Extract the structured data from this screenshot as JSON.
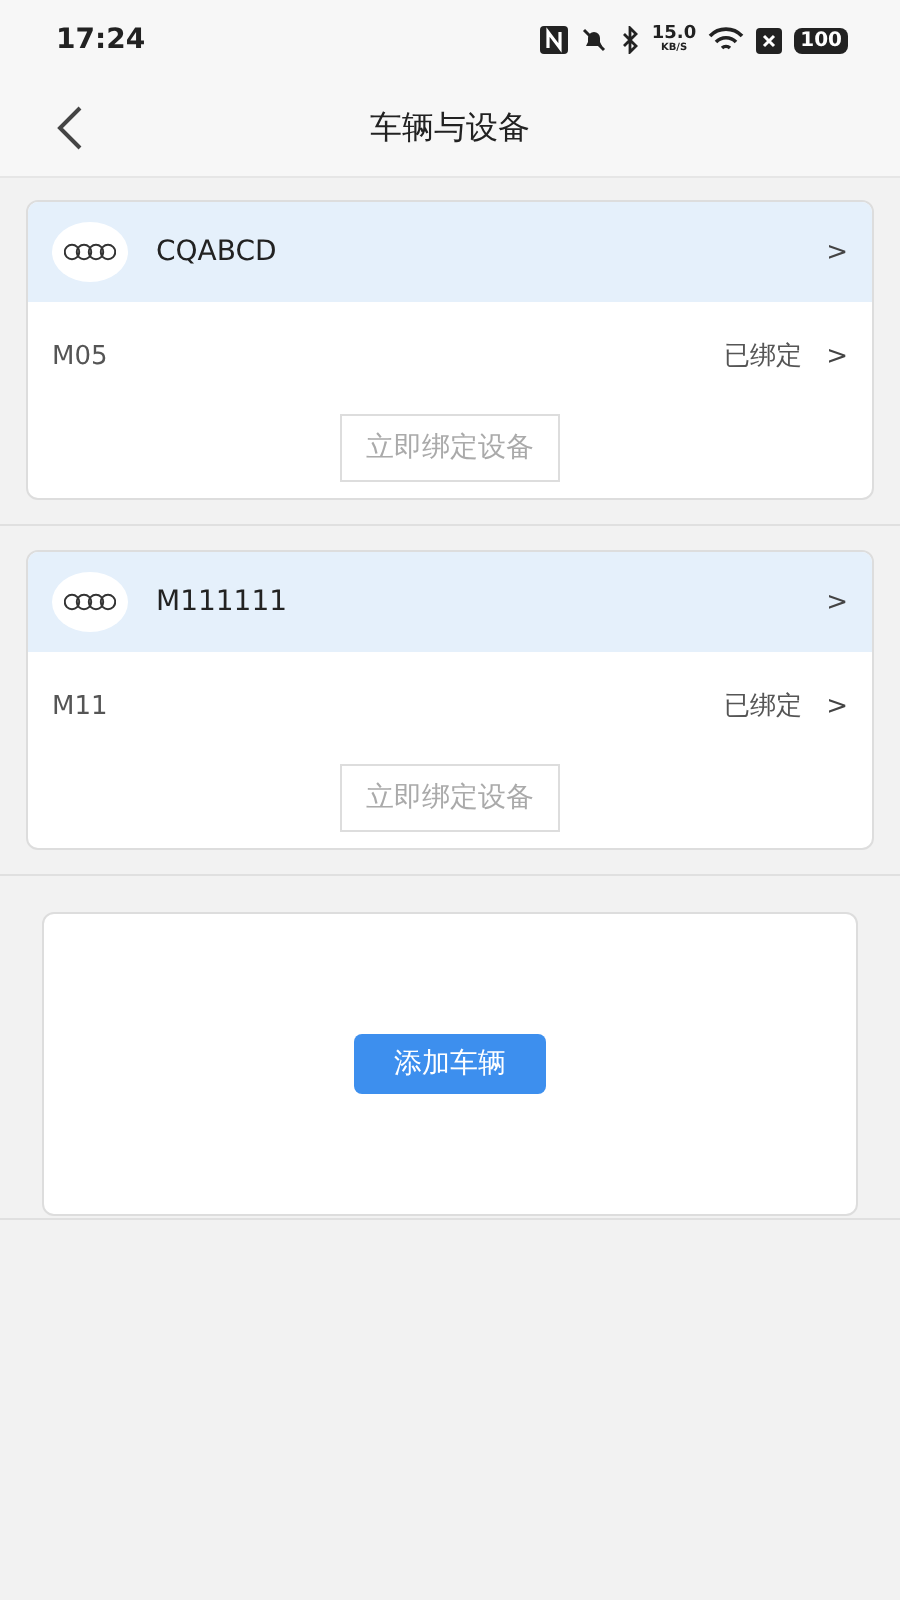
{
  "status_bar": {
    "time": "17:24",
    "speed": "15.0",
    "speed_unit": "KB/S",
    "battery": "100"
  },
  "header": {
    "title": "车辆与设备"
  },
  "vehicles": [
    {
      "plate": "CQABCD",
      "chevron": ">",
      "device": "M05",
      "status": "已绑定",
      "status_chevron": ">",
      "bind_button": "立即绑定设备"
    },
    {
      "plate": "M111111",
      "chevron": ">",
      "device": "M11",
      "status": "已绑定",
      "status_chevron": ">",
      "bind_button": "立即绑定设备"
    }
  ],
  "add_button": "添加车辆"
}
